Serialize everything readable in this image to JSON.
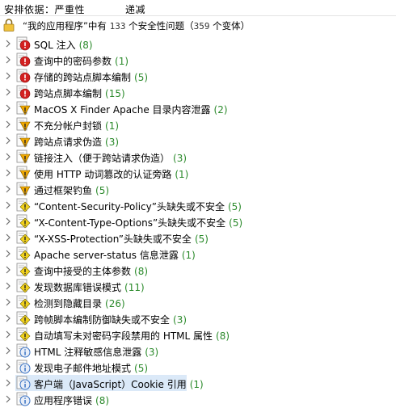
{
  "header": {
    "sort_label": "安排依据：严重性",
    "sort_value": "递减"
  },
  "summary": {
    "prefix": "“我的应用程序”中有",
    "issue_count": "133",
    "issue_text": "个安全性问题（",
    "variant_count": "359",
    "variant_text": "个变体）"
  },
  "issues": [
    {
      "label": "SQL 注入",
      "count": "(8)",
      "severity": "high"
    },
    {
      "label": "查询中的密码参数",
      "count": "(1)",
      "severity": "high"
    },
    {
      "label": "存储的跨站点脚本编制",
      "count": "(5)",
      "severity": "high"
    },
    {
      "label": "跨站点脚本编制",
      "count": "(15)",
      "severity": "high"
    },
    {
      "label": "MacOS X Finder Apache 目录内容泄露",
      "count": "(2)",
      "severity": "medium"
    },
    {
      "label": "不充分帐户封锁",
      "count": "(1)",
      "severity": "medium"
    },
    {
      "label": "跨站点请求伪造",
      "count": "(3)",
      "severity": "medium"
    },
    {
      "label": "链接注入（便于跨站请求伪造）",
      "count": "(3)",
      "severity": "medium"
    },
    {
      "label": "使用 HTTP 动词篡改的认证旁路",
      "count": "(1)",
      "severity": "medium"
    },
    {
      "label": "通过框架钓鱼",
      "count": "(5)",
      "severity": "medium"
    },
    {
      "label": "“Content-Security-Policy”头缺失或不安全",
      "count": "(5)",
      "severity": "low"
    },
    {
      "label": "“X-Content-Type-Options”头缺失或不安全",
      "count": "(5)",
      "severity": "low"
    },
    {
      "label": "“X-XSS-Protection”头缺失或不安全",
      "count": "(5)",
      "severity": "low"
    },
    {
      "label": "Apache server-status 信息泄露",
      "count": "(1)",
      "severity": "low"
    },
    {
      "label": "查询中接受的主体参数",
      "count": "(8)",
      "severity": "low"
    },
    {
      "label": "发现数据库错误模式",
      "count": "(11)",
      "severity": "low"
    },
    {
      "label": "检测到隐藏目录",
      "count": "(26)",
      "severity": "low"
    },
    {
      "label": "跨帧脚本编制防御缺失或不安全",
      "count": "(3)",
      "severity": "low"
    },
    {
      "label": "自动填写未对密码字段禁用的 HTML 属性",
      "count": "(8)",
      "severity": "low"
    },
    {
      "label": "HTML 注释敏感信息泄露",
      "count": "(3)",
      "severity": "info"
    },
    {
      "label": "发现电子邮件地址模式",
      "count": "(5)",
      "severity": "info"
    },
    {
      "label": "客户端（JavaScript）Cookie 引用",
      "count": "(1)",
      "severity": "info",
      "selected": true
    },
    {
      "label": "应用程序错误",
      "count": "(8)",
      "severity": "info"
    }
  ],
  "colors": {
    "high": "#d32020",
    "medium": "#f0a800",
    "low": "#f2d21c",
    "info": "#3a73c4",
    "count": "#2b8a2b",
    "selection": "#dbe9f8"
  }
}
